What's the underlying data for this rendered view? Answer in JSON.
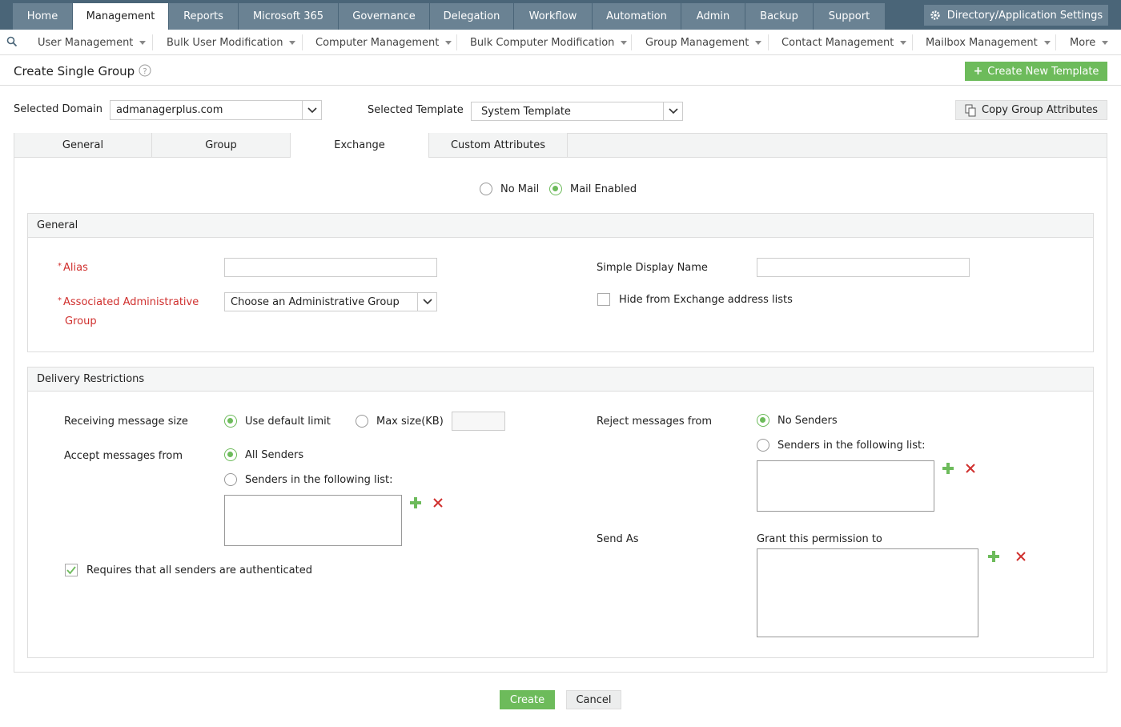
{
  "topnav": {
    "tabs": [
      "Home",
      "Management",
      "Reports",
      "Microsoft 365",
      "Governance",
      "Delegation",
      "Workflow",
      "Automation",
      "Admin",
      "Backup",
      "Support"
    ],
    "active": "Management",
    "settings_label": "Directory/Application Settings"
  },
  "subnav": {
    "items": [
      "User Management",
      "Bulk User Modification",
      "Computer Management",
      "Bulk Computer Modification",
      "Group Management",
      "Contact Management",
      "Mailbox Management",
      "More"
    ]
  },
  "page": {
    "title": "Create Single Group",
    "create_template_label": "Create New Template",
    "domain_label": "Selected Domain",
    "domain_value": "admanagerplus.com",
    "template_label": "Selected Template",
    "template_value": "System Template",
    "copy_attrs_label": "Copy Group Attributes"
  },
  "tabs": [
    "General",
    "Group",
    "Exchange",
    "Custom Attributes"
  ],
  "mail": {
    "no_mail": "No Mail",
    "mail_enabled": "Mail Enabled",
    "selected": "Mail Enabled"
  },
  "general": {
    "heading": "General",
    "alias_label": "Alias",
    "alias_value": "",
    "admin_group_label_1": "Associated Administrative",
    "admin_group_label_2": "Group",
    "admin_group_value": "Choose an Administrative Group",
    "display_name_label": "Simple Display Name",
    "display_name_value": "",
    "hide_label": "Hide from Exchange address lists",
    "hide_checked": false
  },
  "delivery": {
    "heading": "Delivery Restrictions",
    "recv_size_label": "Receiving message size",
    "use_default": "Use default limit",
    "max_size": "Max size(KB)",
    "accept_label": "Accept messages from",
    "all_senders": "All Senders",
    "senders_list": "Senders in the following list:",
    "auth_label": "Requires that all senders are authenticated",
    "auth_checked": true,
    "reject_label": "Reject messages from",
    "no_senders": "No Senders",
    "reject_senders_list": "Senders in the following list:",
    "send_as_label": "Send As",
    "grant_label": "Grant this permission to"
  },
  "footer": {
    "create": "Create",
    "cancel": "Cancel"
  },
  "colors": {
    "nav_bg": "#4a6578",
    "nav_tab": "#6a8293",
    "accent_green": "#6dbb5b",
    "required_red": "#d0302e"
  }
}
